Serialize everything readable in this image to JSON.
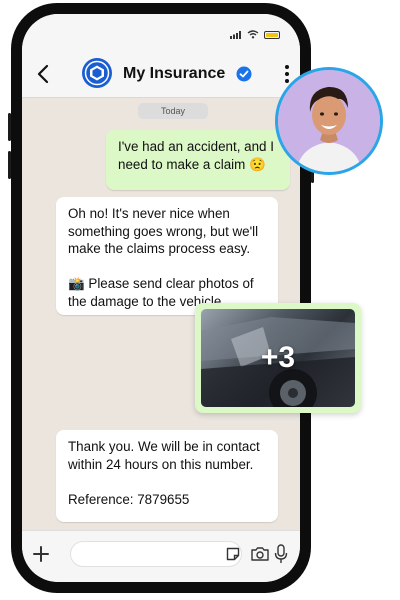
{
  "header": {
    "contact_name": "My Insurance"
  },
  "chat": {
    "date_label": "Today",
    "messages": [
      {
        "direction": "outgoing",
        "lines": [
          "I've had an accident, and I",
          "need to make a claim 😟"
        ]
      },
      {
        "direction": "incoming",
        "paragraphs": [
          [
            "Oh no! It's never nice when",
            "something goes wrong, but we'll",
            "make the claims process easy."
          ],
          [
            "📸 Please send clear photos of",
            "the damage to the vehicle."
          ]
        ]
      },
      {
        "direction": "outgoing",
        "media_count_label": "+3"
      },
      {
        "direction": "incoming",
        "paragraphs": [
          [
            "Thank you. We will be in contact",
            "within 24 hours on this number."
          ],
          [
            "Reference: 7879655"
          ]
        ]
      }
    ]
  },
  "colors": {
    "outgoing_bubble": "#dcf8c6",
    "incoming_bubble": "#ffffff",
    "chat_background": "#ebe5de",
    "verified_badge": "#1a73e8",
    "avatar_ring": "#2aa6e8",
    "battery": "#f1c40f"
  },
  "icons": [
    "back-arrow-icon",
    "insurance-logo-icon",
    "verified-badge-icon",
    "more-options-icon",
    "plus-icon",
    "sticker-icon",
    "camera-icon",
    "microphone-icon",
    "wifi-icon",
    "signal-icon",
    "battery-icon"
  ]
}
